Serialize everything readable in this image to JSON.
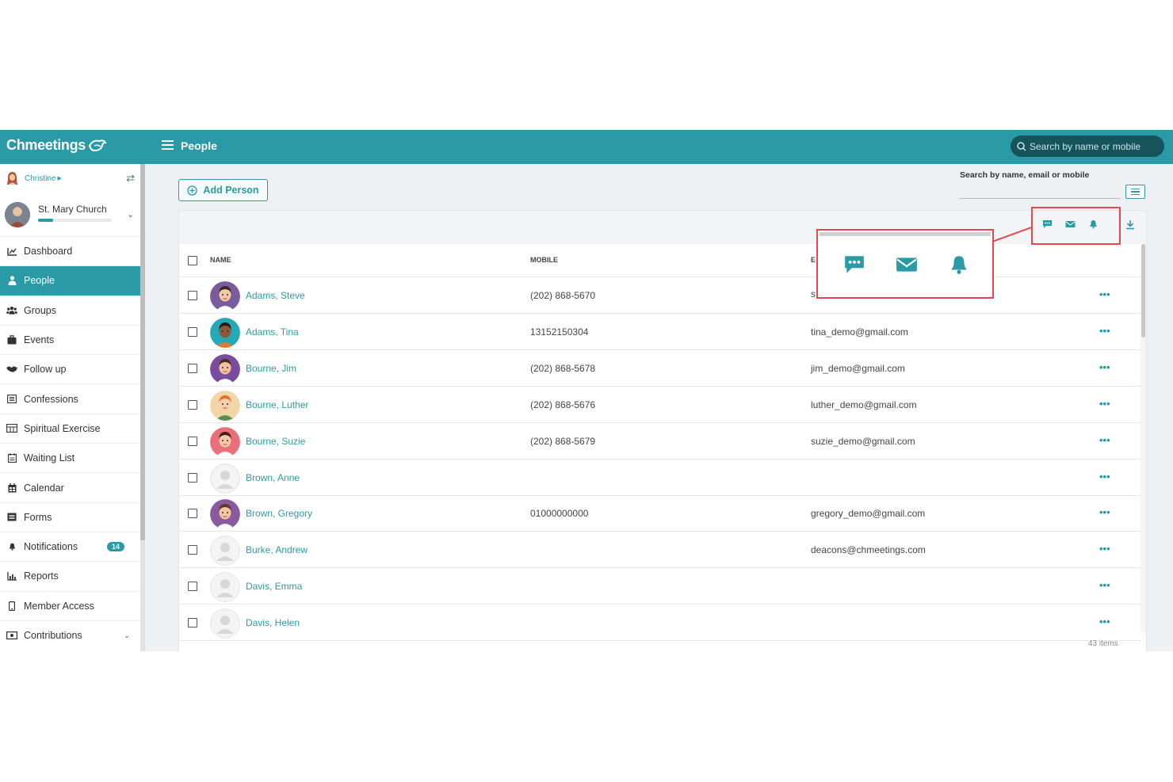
{
  "app": {
    "logo_text": "Chmeetings",
    "page_title": "People",
    "top_search_placeholder": "Search by name or mobile"
  },
  "sidebar": {
    "user_name": "Christine",
    "church_name": "St. Mary Church",
    "church_progress_percent": 20,
    "items": [
      {
        "label": "Dashboard",
        "icon": "chart-line-icon"
      },
      {
        "label": "People",
        "icon": "person-icon",
        "active": true
      },
      {
        "label": "Groups",
        "icon": "users-icon"
      },
      {
        "label": "Events",
        "icon": "briefcase-icon"
      },
      {
        "label": "Follow up",
        "icon": "handshake-icon"
      },
      {
        "label": "Confessions",
        "icon": "list-box-icon"
      },
      {
        "label": "Spiritual Exercise",
        "icon": "calendar-grid-icon"
      },
      {
        "label": "Waiting List",
        "icon": "waiting-list-icon"
      },
      {
        "label": "Calendar",
        "icon": "calendar-icon"
      },
      {
        "label": "Forms",
        "icon": "form-icon"
      },
      {
        "label": "Notifications",
        "icon": "bell-icon",
        "badge": "14"
      },
      {
        "label": "Reports",
        "icon": "bar-chart-icon"
      },
      {
        "label": "Member Access",
        "icon": "mobile-icon"
      },
      {
        "label": "Contributions",
        "icon": "money-icon",
        "chevron": true
      }
    ]
  },
  "content": {
    "add_person_label": "Add Person",
    "search_label": "Search by name, email or mobile",
    "columns": {
      "name": "NAME",
      "mobile": "MOBILE",
      "email": "E"
    },
    "rows": [
      {
        "name": "Adams, Steve",
        "mobile": "(202) 868-5670",
        "email": "s",
        "avatar": "steve"
      },
      {
        "name": "Adams, Tina",
        "mobile": "13152150304",
        "email": "tina_demo@gmail.com",
        "avatar": "tina"
      },
      {
        "name": "Bourne, Jim",
        "mobile": "(202) 868-5678",
        "email": "jim_demo@gmail.com",
        "avatar": "jim"
      },
      {
        "name": "Bourne, Luther",
        "mobile": "(202) 868-5676",
        "email": "luther_demo@gmail.com",
        "avatar": "luther"
      },
      {
        "name": "Bourne, Suzie",
        "mobile": "(202) 868-5679",
        "email": "suzie_demo@gmail.com",
        "avatar": "suzie"
      },
      {
        "name": "Brown, Anne",
        "mobile": "",
        "email": "",
        "avatar": "default"
      },
      {
        "name": "Brown, Gregory",
        "mobile": "01000000000",
        "email": "gregory_demo@gmail.com",
        "avatar": "gregory"
      },
      {
        "name": "Burke, Andrew",
        "mobile": "",
        "email": "deacons@chmeetings.com",
        "avatar": "default"
      },
      {
        "name": "Davis, Emma",
        "mobile": "",
        "email": "",
        "avatar": "default"
      },
      {
        "name": "Davis, Helen",
        "mobile": "",
        "email": "",
        "avatar": "default"
      }
    ],
    "row_menu": "•••",
    "items_count": "43 items"
  },
  "colors": {
    "primary": "#2a9aa6",
    "highlight": "#e5474f"
  }
}
